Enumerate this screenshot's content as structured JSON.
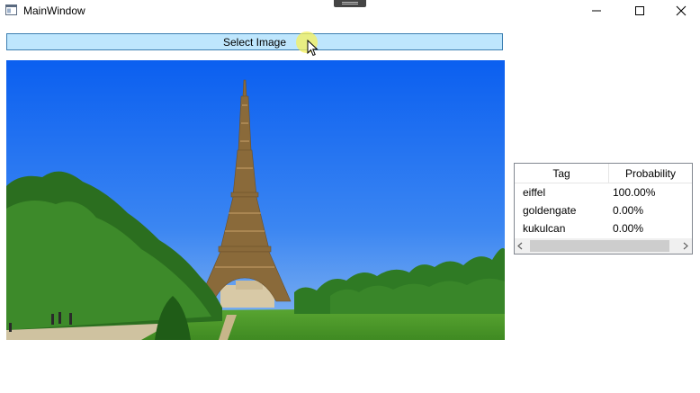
{
  "window": {
    "title": "MainWindow"
  },
  "toolbar": {
    "select_label": "Select Image"
  },
  "list": {
    "headers": {
      "tag": "Tag",
      "probability": "Probability"
    },
    "rows": [
      {
        "tag": "eiffel",
        "probability": "100.00%"
      },
      {
        "tag": "goldengate",
        "probability": "0.00%"
      },
      {
        "tag": "kukulcan",
        "probability": "0.00%"
      }
    ]
  },
  "icons": {
    "app": "window-app-icon",
    "minimize": "minimize-icon",
    "maximize": "maximize-icon",
    "close": "close-icon",
    "cursor": "mouse-pointer-icon",
    "scroll_left": "chevron-left-icon",
    "scroll_right": "chevron-right-icon"
  },
  "colors": {
    "button_bg": "#bee6fd",
    "button_border": "#3c7fb1",
    "sky": "#1e6ef0",
    "grass": "#4e9a2c"
  }
}
